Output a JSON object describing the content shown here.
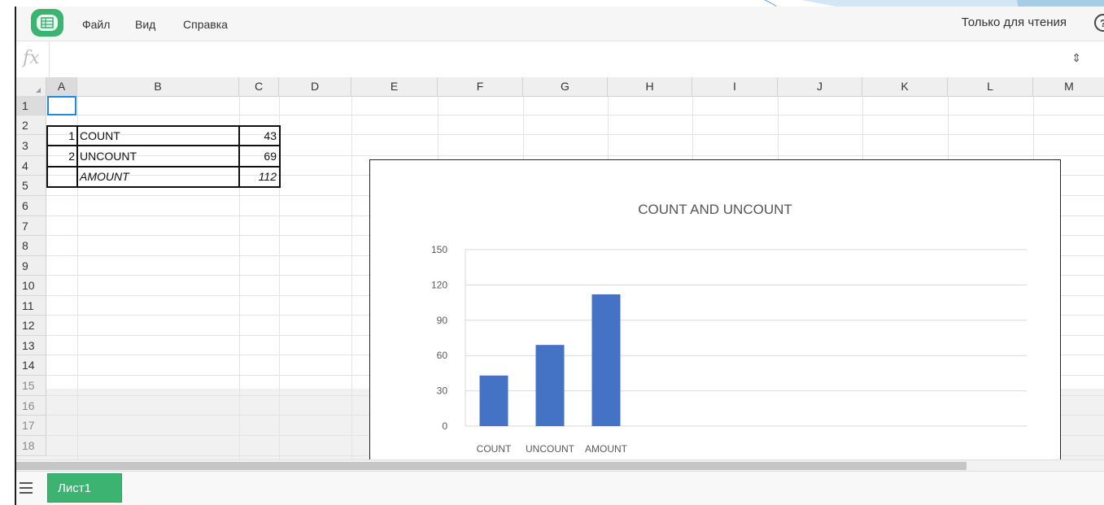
{
  "menubar": {
    "menus": [
      "Файл",
      "Вид",
      "Справка"
    ],
    "status": "Только для чтения",
    "help_glyph": "?",
    "logo_icon": "spreadsheet-app-icon"
  },
  "formula_bar": {
    "fx_label": "fx",
    "value": "",
    "expand_glyph": "⇕"
  },
  "grid": {
    "columns": [
      "A",
      "B",
      "C",
      "D",
      "E",
      "F",
      "G",
      "H",
      "I",
      "J",
      "K",
      "L",
      "M"
    ],
    "rows": [
      "1",
      "2",
      "3",
      "4",
      "5",
      "6",
      "7",
      "8",
      "9",
      "10",
      "11",
      "12",
      "13",
      "14",
      "15",
      "16",
      "17",
      "18"
    ],
    "selected_cell": "A1",
    "cells": {
      "A2": "1",
      "B2": "COUNT",
      "C2": "43",
      "A3": "2",
      "B3": "UNCOUNT",
      "C3": "69",
      "B4": "AMOUNT",
      "C4": "112"
    }
  },
  "chart_data": {
    "type": "bar",
    "title": "COUNT AND UNCOUNT",
    "categories": [
      "COUNT",
      "UNCOUNT",
      "AMOUNT"
    ],
    "values": [
      43,
      69,
      112
    ],
    "yticks": [
      "0",
      "30",
      "60",
      "90",
      "120",
      "150"
    ],
    "ylim": [
      0,
      150
    ],
    "xlabel": "",
    "ylabel": "",
    "grid": true,
    "legend": "none",
    "bar_color": "#4472c4"
  },
  "sheet_tabs": {
    "tabs": [
      "Лист1"
    ],
    "active": "Лист1"
  }
}
